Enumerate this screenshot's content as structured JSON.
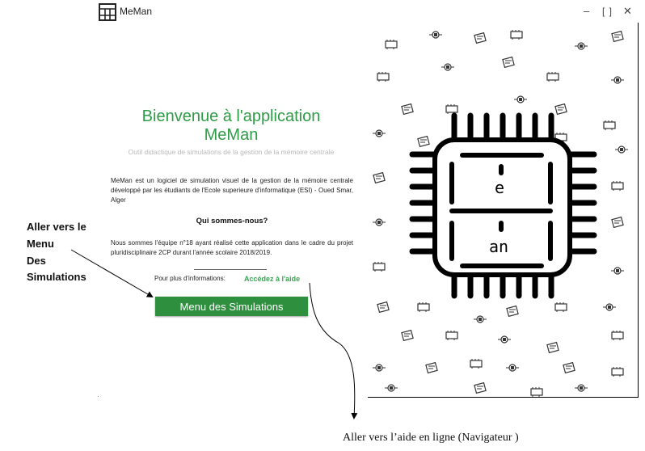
{
  "app": {
    "title": "MeMan"
  },
  "window": {
    "minimize": "–",
    "maximize": "[ ]",
    "close": "✕"
  },
  "welcome": {
    "title": "Bienvenue à l'application MeMan",
    "subtitle": "Outil didactique de simulations de la gestion de la mémoire centrale",
    "about": "MeMan est un logiciel de simulation visuel de la gestion de la mémoire centrale développé par les étudiants de l'Ecole superieure d'informatique (ESI) - Oued Smar, Alger",
    "who_heading": "Qui sommes-nous?",
    "team": "Nous sommes l'équipe n°18 ayant réalisé cette application dans le cadre du projet pluridisciplinaire 2CP durant l'année scolaire 2018/2019.",
    "more_info_label": "Pour plus d'informations:",
    "help_link": "Accédez à l'aide",
    "menu_button": "Menu des Simulations"
  },
  "annotations": {
    "left_lines": [
      "Aller vers le",
      "Menu",
      "Des",
      "Simulations"
    ],
    "bottom": "Aller vers l’aide en ligne (Navigateur )"
  },
  "illustration": {
    "chip_top_text": "e",
    "chip_bottom_text": "an",
    "colors": {
      "ink": "#000000",
      "background": "#ffffff"
    },
    "pattern_icon": "electronics-doodle-icon"
  },
  "colors": {
    "accent": "#2e9b46",
    "button": "#2e8f3f",
    "link": "#3aa655"
  }
}
